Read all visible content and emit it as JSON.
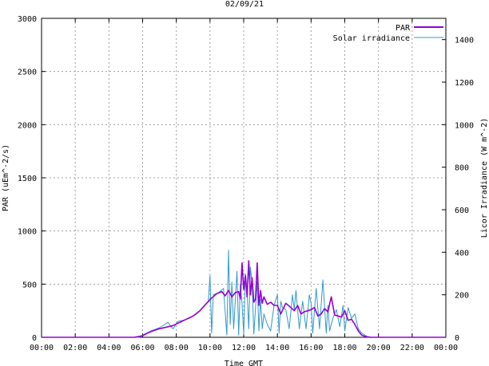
{
  "chart_data": {
    "type": "line",
    "title": "02/09/21",
    "xlabel": "Time GMT",
    "ylabel": "PAR (uEm^-2/s)",
    "y2label": "Licor Irradiance (W m^-2)",
    "xlim": [
      0,
      24
    ],
    "ylim": [
      0,
      3000
    ],
    "y2lim": [
      0,
      1500
    ],
    "grid": true,
    "legend_position": "top-right",
    "x_ticks": [
      "00:00",
      "02:00",
      "04:00",
      "06:00",
      "08:00",
      "10:00",
      "12:00",
      "14:00",
      "16:00",
      "18:00",
      "20:00",
      "22:00",
      "00:00"
    ],
    "y_ticks": [
      "0",
      "500",
      "1000",
      "1500",
      "2000",
      "2500",
      "3000"
    ],
    "y2_ticks": [
      "0",
      "200",
      "400",
      "600",
      "800",
      "1000",
      "1200",
      "1400"
    ],
    "series": [
      {
        "name": "PAR",
        "axis": "left",
        "color": "#9400d3",
        "x": [
          0,
          5.5,
          6.0,
          6.3,
          6.6,
          7.0,
          7.4,
          7.8,
          8.2,
          8.6,
          9.0,
          9.4,
          9.8,
          10.1,
          10.4,
          10.7,
          10.9,
          11.1,
          11.3,
          11.5,
          11.7,
          11.8,
          11.9,
          12.0,
          12.1,
          12.2,
          12.3,
          12.4,
          12.5,
          12.6,
          12.7,
          12.8,
          12.9,
          13.0,
          13.1,
          13.2,
          13.4,
          13.6,
          13.8,
          14.0,
          14.2,
          14.5,
          14.8,
          15.0,
          15.2,
          15.4,
          15.6,
          15.8,
          16.0,
          16.2,
          16.4,
          16.6,
          16.8,
          17.0,
          17.2,
          17.4,
          17.6,
          17.8,
          18.0,
          18.2,
          18.4,
          18.6,
          18.8,
          19.0,
          19.2,
          19.5,
          24
        ],
        "y": [
          0,
          0,
          15,
          40,
          60,
          80,
          95,
          110,
          140,
          170,
          200,
          250,
          320,
          370,
          410,
          430,
          390,
          440,
          380,
          420,
          430,
          360,
          700,
          450,
          580,
          380,
          720,
          400,
          560,
          330,
          360,
          700,
          300,
          440,
          320,
          380,
          310,
          330,
          300,
          300,
          220,
          320,
          280,
          250,
          300,
          220,
          240,
          250,
          260,
          280,
          200,
          220,
          270,
          240,
          380,
          210,
          200,
          190,
          250,
          160,
          170,
          120,
          60,
          20,
          8,
          0,
          0
        ]
      },
      {
        "name": "Solar irradiance",
        "axis": "right",
        "color": "#3399cc",
        "x": [
          0,
          5.8,
          6.0,
          6.5,
          7.0,
          7.5,
          7.8,
          8.1,
          8.4,
          8.8,
          9.2,
          9.6,
          9.9,
          10.0,
          10.1,
          10.2,
          10.5,
          10.8,
          11.0,
          11.1,
          11.2,
          11.3,
          11.4,
          11.6,
          11.7,
          11.8,
          11.9,
          12.0,
          12.1,
          12.2,
          12.3,
          12.4,
          12.5,
          12.6,
          12.7,
          12.8,
          12.9,
          13.0,
          13.1,
          13.2,
          13.4,
          13.6,
          13.8,
          14.0,
          14.1,
          14.2,
          14.3,
          14.5,
          14.7,
          14.9,
          15.0,
          15.1,
          15.3,
          15.5,
          15.7,
          15.9,
          16.0,
          16.1,
          16.3,
          16.5,
          16.7,
          16.9,
          17.0,
          17.1,
          17.3,
          17.5,
          17.7,
          17.9,
          18.0,
          18.2,
          18.4,
          18.6,
          18.8,
          19.0,
          19.3,
          19.6,
          24
        ],
        "y": [
          0,
          0,
          10,
          30,
          45,
          70,
          40,
          75,
          80,
          90,
          110,
          140,
          170,
          290,
          20,
          200,
          210,
          230,
          10,
          410,
          60,
          260,
          40,
          310,
          10,
          250,
          160,
          15,
          300,
          220,
          40,
          330,
          250,
          15,
          140,
          260,
          30,
          180,
          40,
          110,
          60,
          30,
          150,
          200,
          20,
          170,
          140,
          130,
          40,
          200,
          130,
          220,
          40,
          170,
          40,
          200,
          160,
          20,
          230,
          40,
          270,
          20,
          150,
          30,
          90,
          130,
          50,
          150,
          30,
          140,
          90,
          110,
          40,
          20,
          5,
          0,
          0
        ]
      }
    ]
  }
}
